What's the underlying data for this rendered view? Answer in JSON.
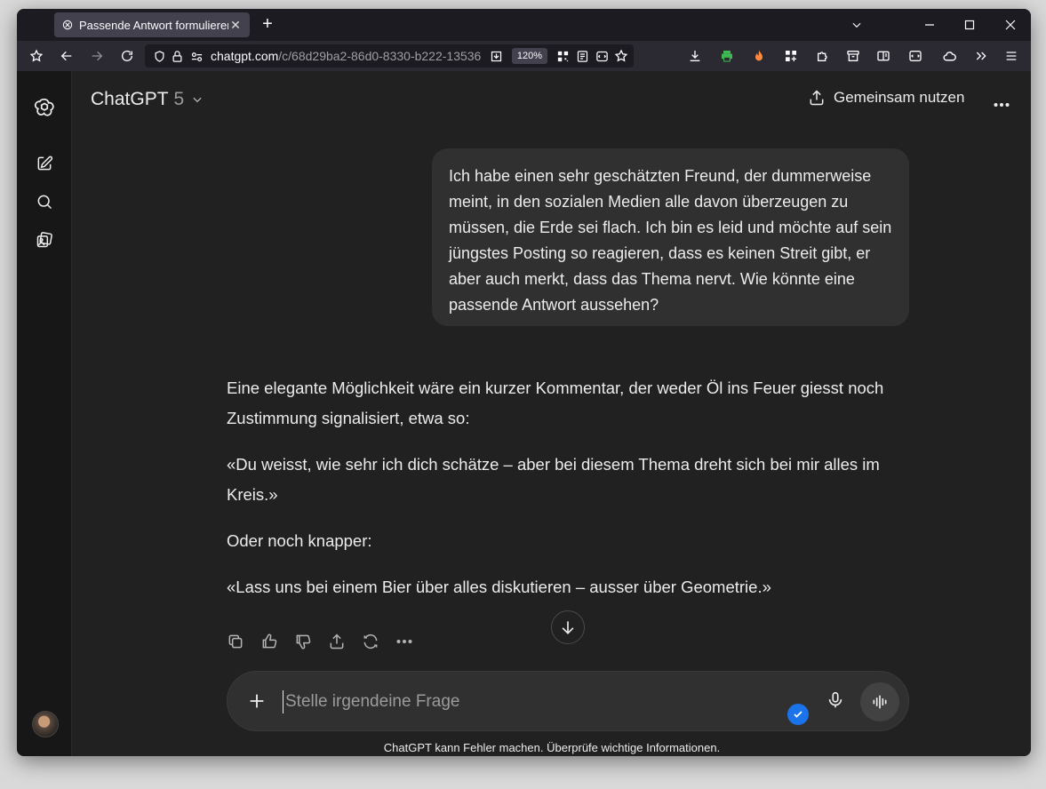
{
  "browser": {
    "tab_title": "Passende Antwort formulieren",
    "url_host": "chatgpt.com",
    "url_path": "/c/68d29ba2-86d0-8330-b222-13536",
    "zoom": "120%"
  },
  "header": {
    "model_name": "ChatGPT",
    "model_version": "5",
    "share_label": "Gemeinsam nutzen"
  },
  "conversation": {
    "user_message": "Ich habe einen sehr geschätzten Freund, der dummerweise meint, in den sozialen Medien alle davon überzeugen zu müssen, die Erde sei flach. Ich bin es leid und möchte auf sein jüngstes Posting so reagieren, dass es keinen Streit gibt, er aber auch merkt, dass das Thema nervt. Wie könnte eine passende Antwort aussehen?",
    "assistant_paragraphs": [
      "Eine elegante Möglichkeit wäre ein kurzer Kommentar, der weder Öl ins Feuer giesst noch Zustimmung signalisiert, etwa so:",
      "«Du weisst, wie sehr ich dich schätze – aber bei diesem Thema dreht sich bei mir alles im Kreis.»",
      "Oder noch knapper:",
      "«Lass uns bei einem Bier über alles diskutieren – ausser über Geometrie.»"
    ]
  },
  "composer": {
    "placeholder": "Stelle irgendeine Frage"
  },
  "footer": {
    "disclaimer": "ChatGPT kann Fehler machen. Überprüfe wichtige Informationen."
  },
  "colors": {
    "background": "#212121",
    "sidebar": "#171717",
    "bubble": "#303030",
    "accent": "#1a73e8"
  }
}
